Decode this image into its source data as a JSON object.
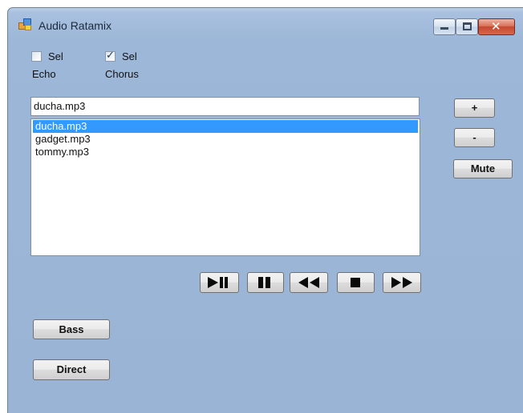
{
  "window": {
    "title": "Audio Ratamix",
    "controls": [
      "minimize-icon",
      "maximize-icon",
      "close-icon"
    ],
    "close_glyph": "✕"
  },
  "effects": {
    "echo": {
      "label": "Sel",
      "caption": "Echo",
      "checked": false
    },
    "chorus": {
      "label": "Sel",
      "caption": "Chorus",
      "checked": true,
      "tick": "✓"
    }
  },
  "file_input": {
    "value": "ducha.mp3"
  },
  "playlist": {
    "items": [
      {
        "label": "ducha.mp3",
        "selected": true
      },
      {
        "label": "gadget.mp3",
        "selected": false
      },
      {
        "label": "tommy.mp3",
        "selected": false
      }
    ]
  },
  "volume": {
    "plus_label": "+",
    "minus_label": "-",
    "mute_label": "Mute"
  },
  "transport": {
    "buttons": [
      "play-pause-icon",
      "pause-icon",
      "rewind-icon",
      "stop-icon",
      "fast-forward-icon"
    ]
  },
  "bottom": {
    "bass_label": "Bass",
    "direct_label": "Direct"
  },
  "colors": {
    "window_bg": "#9db7d8",
    "selection": "#3399ff"
  }
}
